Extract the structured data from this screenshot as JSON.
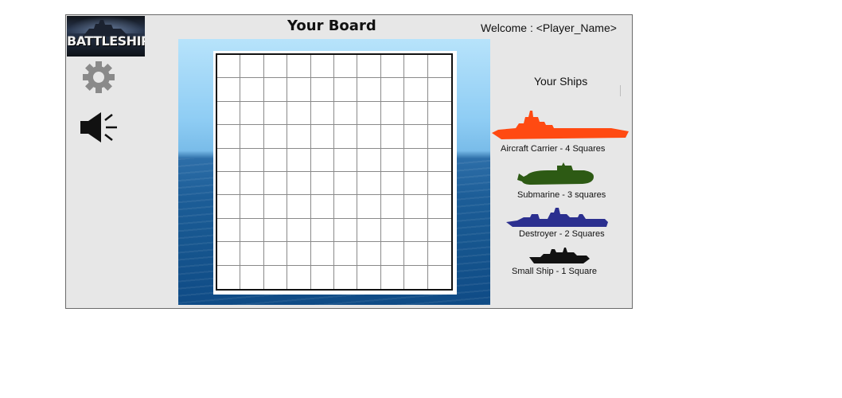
{
  "logo": {
    "text": "BATTLESHIP"
  },
  "header": {
    "board_title": "Your Board",
    "welcome": "Welcome : <Player_Name>"
  },
  "toolbar": {
    "settings_icon": "gear-icon",
    "sound_icon": "speaker-icon"
  },
  "board": {
    "rows": 10,
    "cols": 10
  },
  "ships_panel": {
    "title": "Your Ships",
    "ships": [
      {
        "label": "Aircraft Carrier - 4 Squares",
        "color": "#ff4a12"
      },
      {
        "label": "Submarine - 3 squares",
        "color": "#2d5a14"
      },
      {
        "label": "Destroyer - 2 Squares",
        "color": "#2b2f8f"
      },
      {
        "label": "Small Ship - 1 Square",
        "color": "#111111"
      }
    ]
  }
}
